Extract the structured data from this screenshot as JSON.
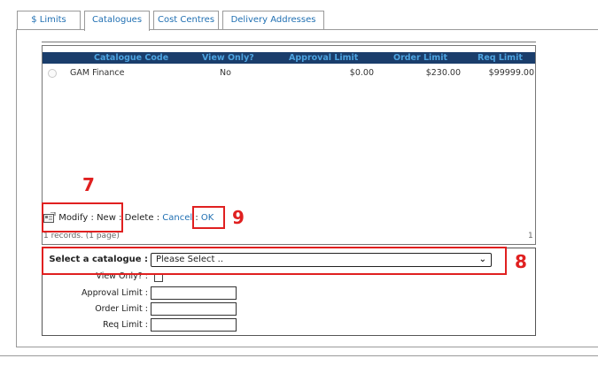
{
  "tabs": [
    "$ Limits",
    "Catalogues",
    "Cost Centres",
    "Delivery Addresses"
  ],
  "grid": {
    "columns": [
      "Catalogue Code",
      "View Only?",
      "Approval Limit",
      "Order Limit",
      "Req Limit"
    ],
    "rows": [
      {
        "code": "GAM Finance",
        "view_only": "No",
        "approval": "$0.00",
        "order": "$230.00",
        "req": "$99999.00"
      }
    ]
  },
  "toolbar": {
    "modify": "Modify",
    "sep": ":",
    "new": "New",
    "delete": "Delete",
    "cancel": "Cancel",
    "ok": "OK"
  },
  "records": "1 records. (1 page)",
  "page_number": "1",
  "form": {
    "select_label": "Select a catalogue :",
    "select_value": "Please Select ..",
    "view_only_label": "View Only? :",
    "approval_label": "Approval Limit :",
    "order_label": "Order Limit :",
    "req_label": "Req Limit :"
  },
  "annotations": [
    "7",
    "9",
    "8"
  ],
  "colors": {
    "header_bg": "#1a3d6b",
    "header_text": "#4da3e0",
    "link": "#1f6fb2",
    "annotation": "#e02020"
  },
  "icons": {
    "modify": "modify-icon",
    "select": "chevron-down-icon"
  }
}
